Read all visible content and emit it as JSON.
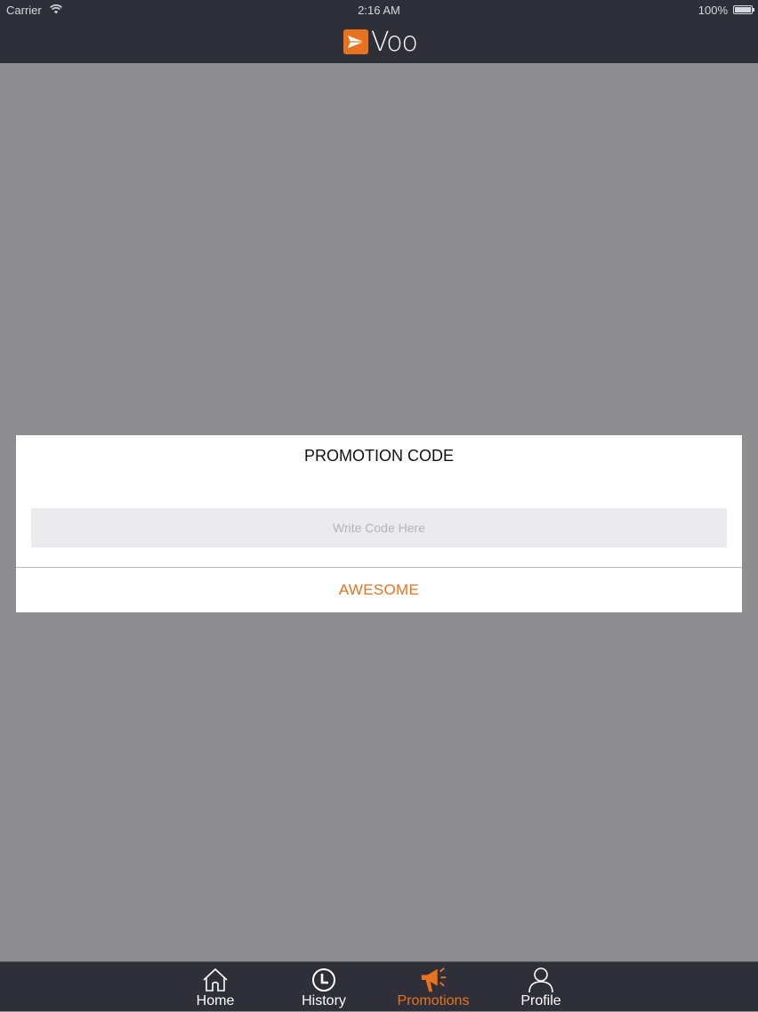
{
  "status_bar": {
    "carrier": "Carrier",
    "time": "2:16 AM",
    "battery": "100%"
  },
  "navbar": {
    "logo_text": "Voo"
  },
  "dialog": {
    "title": "PROMOTION CODE",
    "input_placeholder": "Write Code Here",
    "input_value": "",
    "button_label": "AWESOME"
  },
  "tabbar": {
    "items": [
      {
        "label": "Home",
        "icon": "home-icon",
        "active": false
      },
      {
        "label": "History",
        "icon": "clock-icon",
        "active": false
      },
      {
        "label": "Promotions",
        "icon": "megaphone-icon",
        "active": true
      },
      {
        "label": "Profile",
        "icon": "person-icon",
        "active": false
      }
    ]
  },
  "colors": {
    "accent": "#e8731f",
    "bar_background": "#2e2f38",
    "overlay": "#8e8d90"
  }
}
